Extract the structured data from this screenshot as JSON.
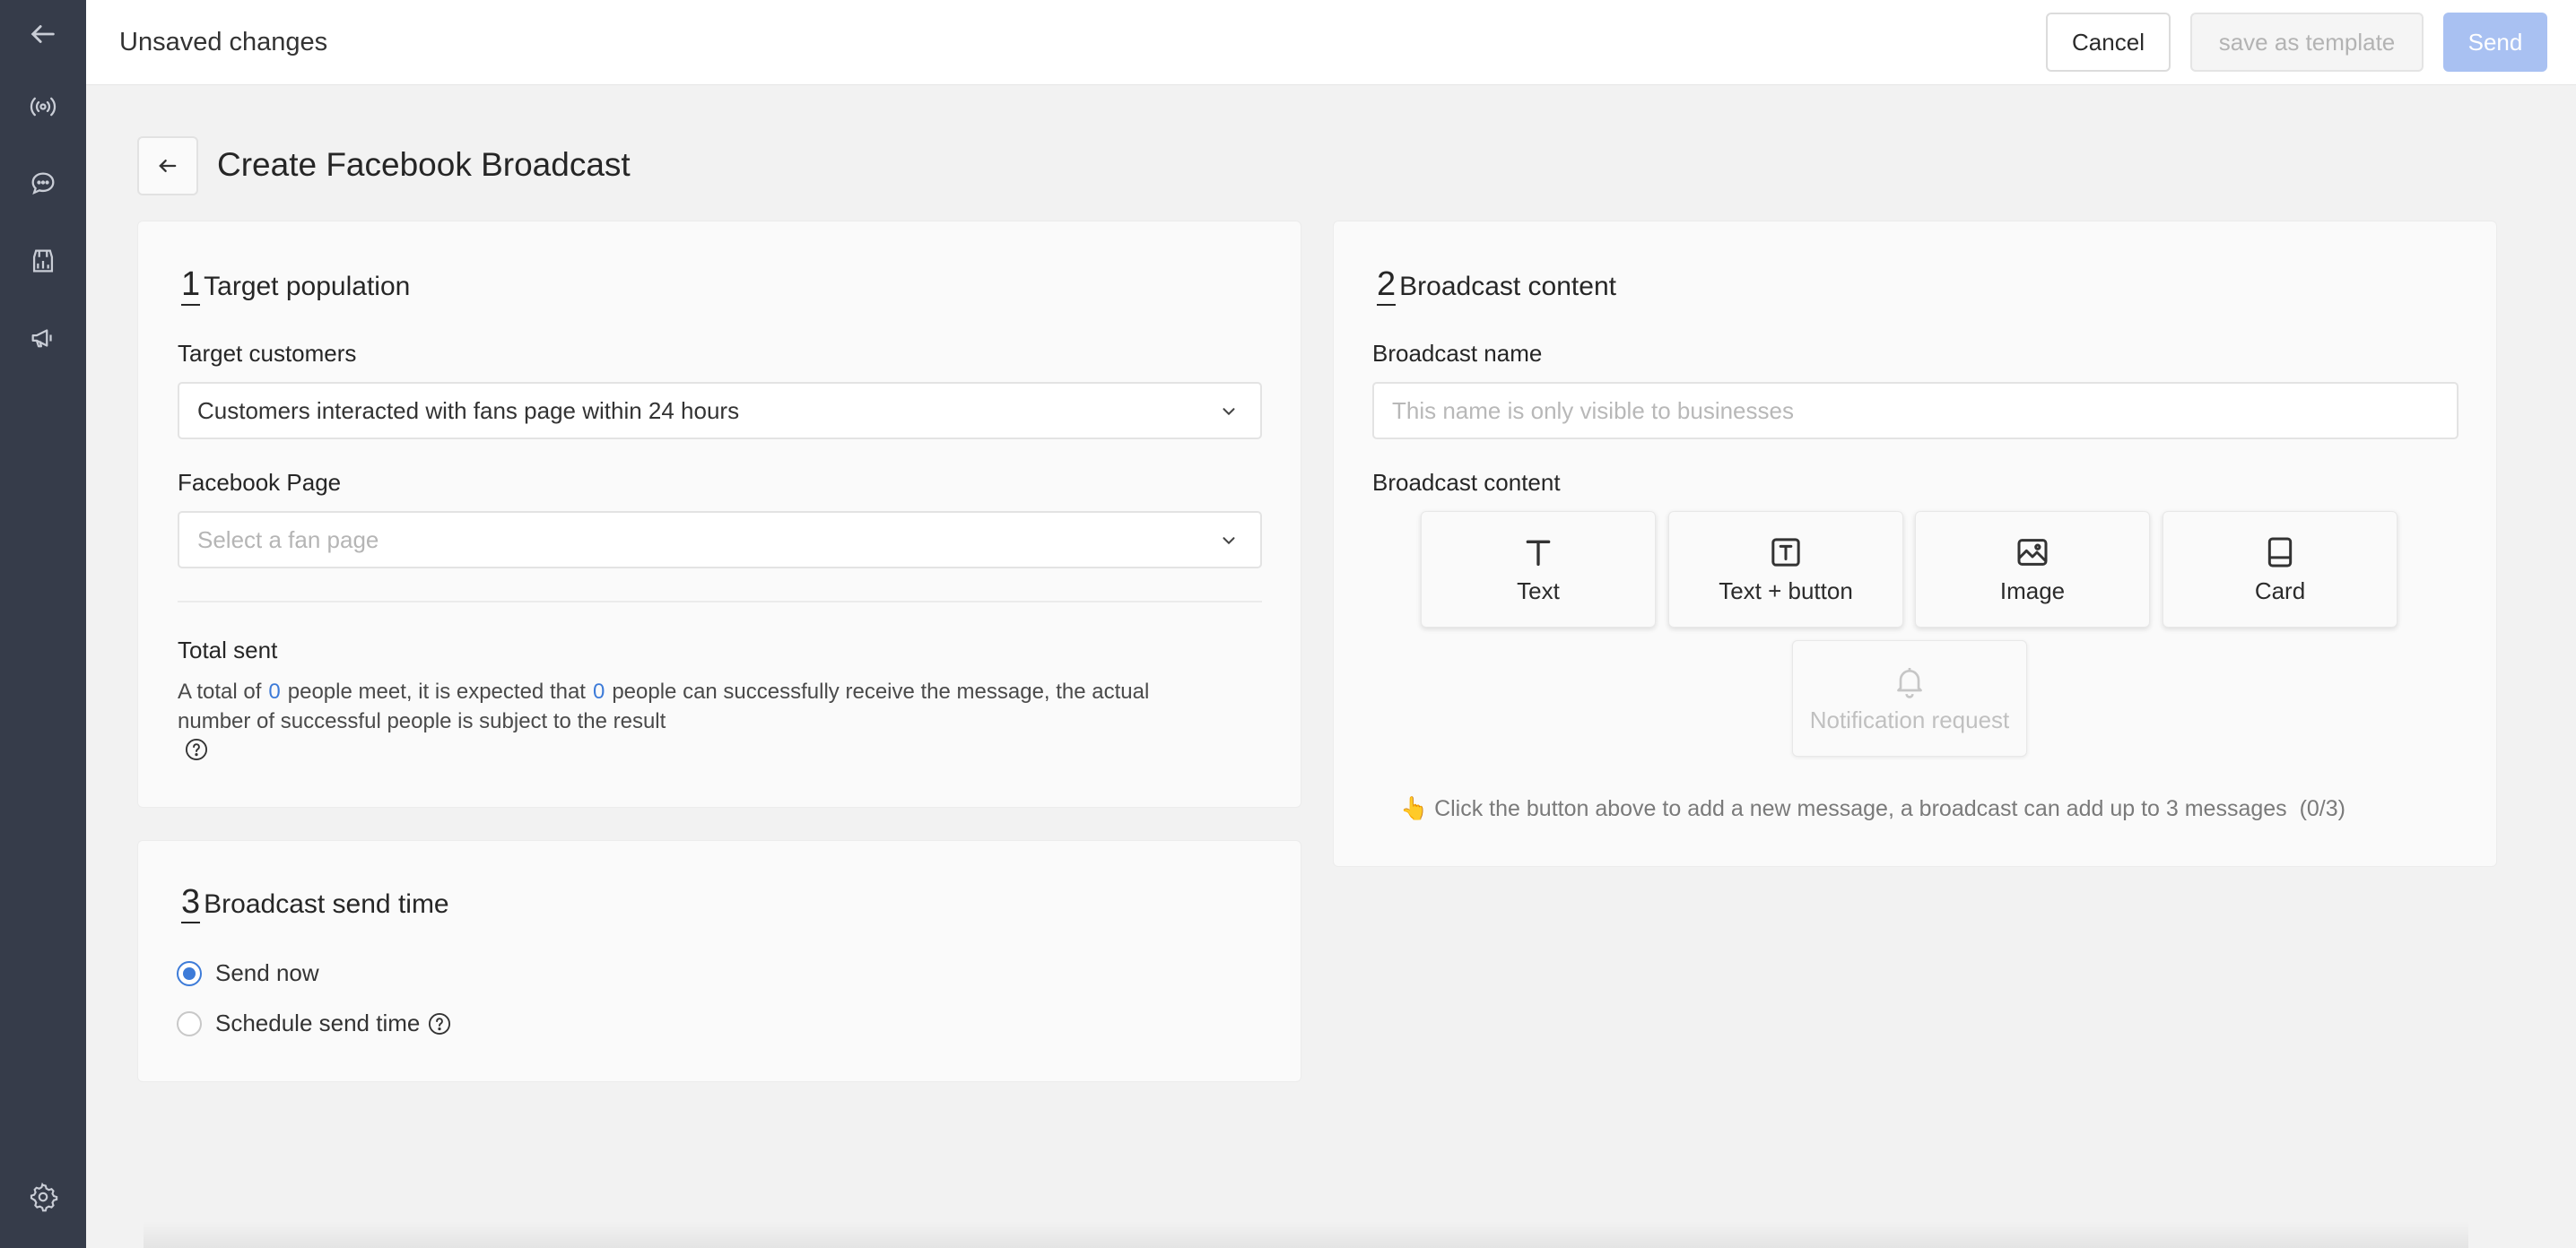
{
  "sidebar": {
    "items": [
      {
        "icon": "arrow-left-icon"
      },
      {
        "icon": "broadcast-icon"
      },
      {
        "icon": "chat-bubble-icon"
      },
      {
        "icon": "store-icon"
      },
      {
        "icon": "megaphone-icon"
      }
    ],
    "bottom": {
      "icon": "gear-icon"
    }
  },
  "topbar": {
    "title": "Unsaved changes",
    "cancel_label": "Cancel",
    "template_label": "save as template",
    "send_label": "Send"
  },
  "page": {
    "title": "Create Facebook Broadcast"
  },
  "target": {
    "number": "1",
    "title": "Target population",
    "customers_label": "Target customers",
    "customers_value": "Customers interacted with fans page within 24 hours",
    "page_label": "Facebook Page",
    "page_placeholder": "Select a fan page",
    "total_label": "Total sent",
    "total_text_1": "A total of",
    "total_count": "0",
    "total_text_2": "people meet, it is expected that",
    "expected_count": "0",
    "total_text_3": "people can successfully receive the message, the actual",
    "total_text_4": "number of successful people is subject to the result"
  },
  "content": {
    "number": "2",
    "title": "Broadcast content",
    "name_label": "Broadcast name",
    "name_placeholder": "This name is only visible to businesses",
    "content_label": "Broadcast content",
    "tiles": [
      {
        "label": "Text",
        "icon": "text-icon"
      },
      {
        "label": "Text + button",
        "icon": "text-button-icon"
      },
      {
        "label": "Image",
        "icon": "image-icon"
      },
      {
        "label": "Card",
        "icon": "card-icon"
      },
      {
        "label": "Notification request",
        "icon": "bell-icon",
        "disabled": true
      }
    ],
    "hint": "👆 Click the button above to add a new message, a broadcast can add up to 3 messages  (0/3)"
  },
  "send_time": {
    "number": "3",
    "title": "Broadcast send time",
    "options": [
      {
        "label": "Send now",
        "checked": true
      },
      {
        "label": "Schedule send time",
        "checked": false
      }
    ]
  },
  "colors": {
    "sidebar": "#363c4a",
    "accent": "#3d7bd8",
    "send_button": "#a9c1f2"
  }
}
